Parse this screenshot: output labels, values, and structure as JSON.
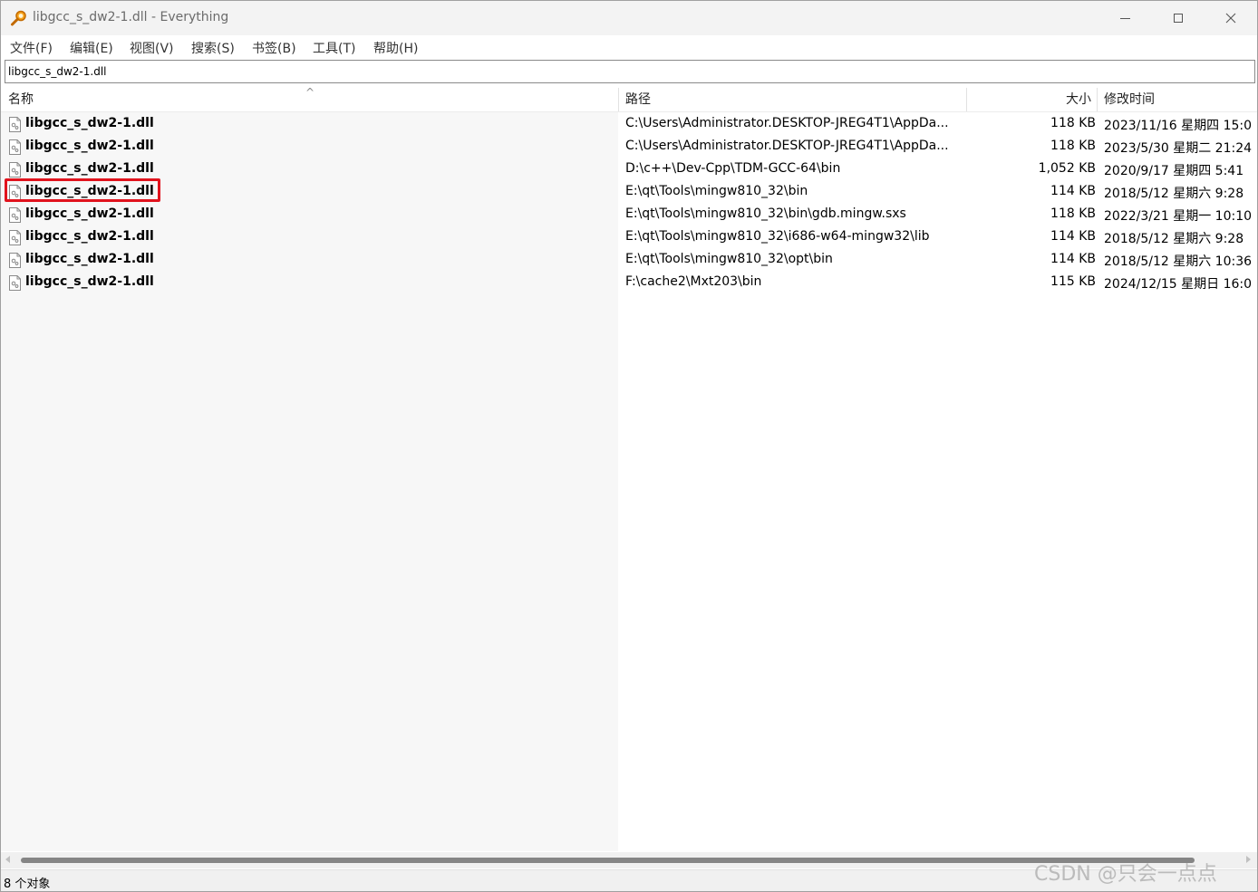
{
  "window": {
    "title": "libgcc_s_dw2-1.dll - Everything",
    "icon": "magnifier-icon"
  },
  "menu": [
    {
      "label": "文件(F)"
    },
    {
      "label": "编辑(E)"
    },
    {
      "label": "视图(V)"
    },
    {
      "label": "搜索(S)"
    },
    {
      "label": "书签(B)"
    },
    {
      "label": "工具(T)"
    },
    {
      "label": "帮助(H)"
    }
  ],
  "search": {
    "value": "libgcc_s_dw2-1.dll"
  },
  "columns": {
    "name": "名称",
    "path": "路径",
    "size": "大小",
    "modified": "修改时间",
    "sort_indicator": "^"
  },
  "rows": [
    {
      "name": "libgcc_s_dw2-1.dll",
      "path": "C:\\Users\\Administrator.DESKTOP-JREG4T1\\AppDa...",
      "size": "118 KB",
      "modified": "2023/11/16 星期四 15:0"
    },
    {
      "name": "libgcc_s_dw2-1.dll",
      "path": "C:\\Users\\Administrator.DESKTOP-JREG4T1\\AppDa...",
      "size": "118 KB",
      "modified": "2023/5/30 星期二 21:24"
    },
    {
      "name": "libgcc_s_dw2-1.dll",
      "path": "D:\\c++\\Dev-Cpp\\TDM-GCC-64\\bin",
      "size": "1,052 KB",
      "modified": "2020/9/17 星期四 5:41"
    },
    {
      "name": "libgcc_s_dw2-1.dll",
      "path": "E:\\qt\\Tools\\mingw810_32\\bin",
      "size": "114 KB",
      "modified": "2018/5/12 星期六 9:28"
    },
    {
      "name": "libgcc_s_dw2-1.dll",
      "path": "E:\\qt\\Tools\\mingw810_32\\bin\\gdb.mingw.sxs",
      "size": "118 KB",
      "modified": "2022/3/21 星期一 10:10"
    },
    {
      "name": "libgcc_s_dw2-1.dll",
      "path": "E:\\qt\\Tools\\mingw810_32\\i686-w64-mingw32\\lib",
      "size": "114 KB",
      "modified": "2018/5/12 星期六 9:28"
    },
    {
      "name": "libgcc_s_dw2-1.dll",
      "path": "E:\\qt\\Tools\\mingw810_32\\opt\\bin",
      "size": "114 KB",
      "modified": "2018/5/12 星期六 10:36"
    },
    {
      "name": "libgcc_s_dw2-1.dll",
      "path": "F:\\cache2\\Mxt203\\bin",
      "size": "115 KB",
      "modified": "2024/12/15 星期日 16:0"
    }
  ],
  "status": {
    "text": "8 个对象"
  },
  "watermark": "CSDN @只会一点点",
  "colors": {
    "highlight": "#e1131d",
    "name_pane_bg": "#f7f7f7"
  }
}
